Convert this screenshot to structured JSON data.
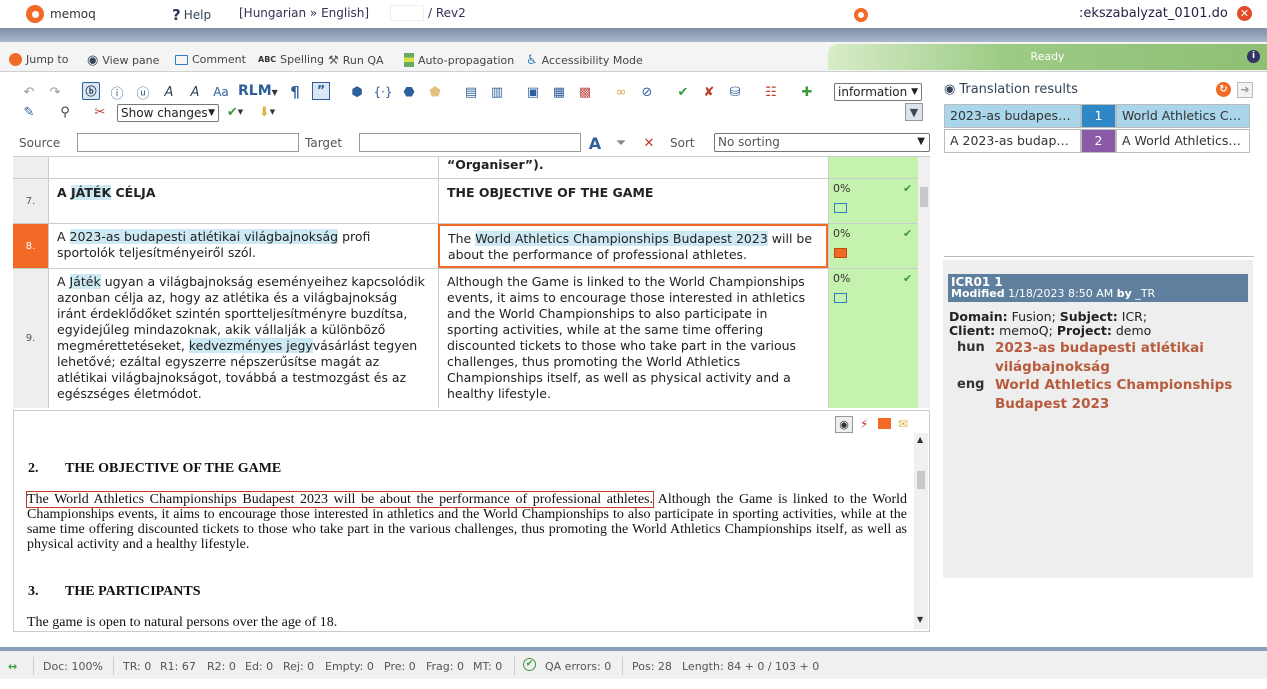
{
  "app": {
    "logo_text": "memoq",
    "help_label": "Help",
    "lang_pair": "[Hungarian » English]",
    "revision": "/ Rev2",
    "doc_tab_title": ":ekszabalyzat_0101.do"
  },
  "menu": {
    "jump_to": "Jump to",
    "view_pane": "View pane",
    "comment": "Comment",
    "spelling": "Spelling",
    "run_qa": "Run QA",
    "auto_propagation": "Auto-propagation",
    "accessibility_mode": "Accessibility Mode",
    "status": "Ready"
  },
  "toolbar": {
    "rlm_label": "RLM",
    "view_select": "information",
    "changes_select": "Show changes"
  },
  "filter": {
    "source_label": "Source",
    "target_label": "Target",
    "sort_label": "Sort",
    "sort_value": "No sorting"
  },
  "grid": {
    "partial_row_target": "“Organiser”).",
    "rows": [
      {
        "num": "7.",
        "source_pre": "A ",
        "source_term": "JÁTÉK",
        "source_post": " CÉLJA",
        "target": "THE OBJECTIVE OF THE GAME",
        "pct": "0%"
      },
      {
        "num": "8.",
        "source_pre": "A ",
        "source_term": "2023-as budapesti atlétikai világbajnokság",
        "source_post": " profi sportolók teljesítményeiről szól.",
        "target_pre": "The ",
        "target_term": "World Athletics Championships Budapest 2023",
        "target_post": " will be about the performance of professional athletes.",
        "pct": "0%"
      },
      {
        "num": "9.",
        "source_pre": "A ",
        "source_term": "Játék",
        "source_mid": " ugyan a világbajnokság eseményeihez kapcsolódik azonban célja az, hogy az atlétika és a világbajnokság iránt érdeklődőket szintén sportteljesítményre buzdítsa, egyidejűleg mindazoknak, akik vállalják a különböző megmérettetéseket, ",
        "source_term2": "kedvezményes jegy",
        "source_post": "vásárlást tegyen lehetővé; ezáltal egyszerre népszerűsítse magát az atlétikai világbajnokságot, továbbá a testmozgást és az egészséges életmódot.",
        "target": "Although the Game is linked to the World Championships events, it aims to encourage those interested in athletics and  the World Championships to also participate in sporting activities, while at the same time offering discounted tickets to those who take part in the various challenges, thus promoting the World Athletics Championships itself, as well as physical activity and a healthy lifestyle.",
        "pct": "0%"
      }
    ]
  },
  "preview": {
    "h2_num": "2.",
    "h2_title": "THE OBJECTIVE OF THE GAME",
    "para_highlight": "The World Athletics Championships Budapest 2023 will be about the performance of professional athletes.",
    "para_rest": " Although the Game is linked to the World Championships events, it aims to encourage those interested in athletics and the World Championships to also participate in sporting activities, while at the same time offering discounted tickets to those who take part in the various challenges, thus promoting the World Athletics Championships itself, as well as physical activity and a healthy lifestyle.",
    "h3_num": "3.",
    "h3_title": "THE PARTICIPANTS",
    "para2": "The game is open to natural persons over the age of 18."
  },
  "translation_results": {
    "title": "Translation results",
    "items": [
      {
        "source": "2023-as budapesti ...",
        "rank": "1",
        "target": "World Athletics Cha..."
      },
      {
        "source": "A 2023-as budapes...",
        "rank": "2",
        "target": "A World Athletics C..."
      }
    ]
  },
  "entry_detail": {
    "title": "ICR01 1",
    "modified_prefix": "Modified",
    "modified_date": "1/18/2023 8:50 AM",
    "by_label": "by",
    "user": "_TR",
    "domain_label": "Domain:",
    "domain_value": "Fusion;",
    "subject_label": "Subject:",
    "subject_value": "ICR;",
    "client_label": "Client:",
    "client_value": "memoQ;",
    "project_label": "Project:",
    "project_value": "demo",
    "hun_label": "hun",
    "hun_term": "2023-as budapesti atlétikai világbajnokság",
    "eng_label": "eng",
    "eng_term": "World Athletics Championships Budapest 2023"
  },
  "statusbar": {
    "doc": "Doc: 100%",
    "tr": "TR: 0",
    "r1": "R1: 67",
    "r2": "R2: 0",
    "ed": "Ed: 0",
    "rej": "Rej: 0",
    "empty": "Empty: 0",
    "pre": "Pre: 0",
    "frag": "Frag: 0",
    "mt": "MT: 0",
    "qa": "QA errors: 0",
    "pos": "Pos: 28",
    "length": "Length: 84 + 0 / 103 + 0"
  },
  "colors": {
    "accent": "#f26a26",
    "confirmed_green": "#c6f2b0",
    "term_highlight": "#cde9f3",
    "rank1": "#2f87c6",
    "rank2": "#8a5aa6"
  }
}
